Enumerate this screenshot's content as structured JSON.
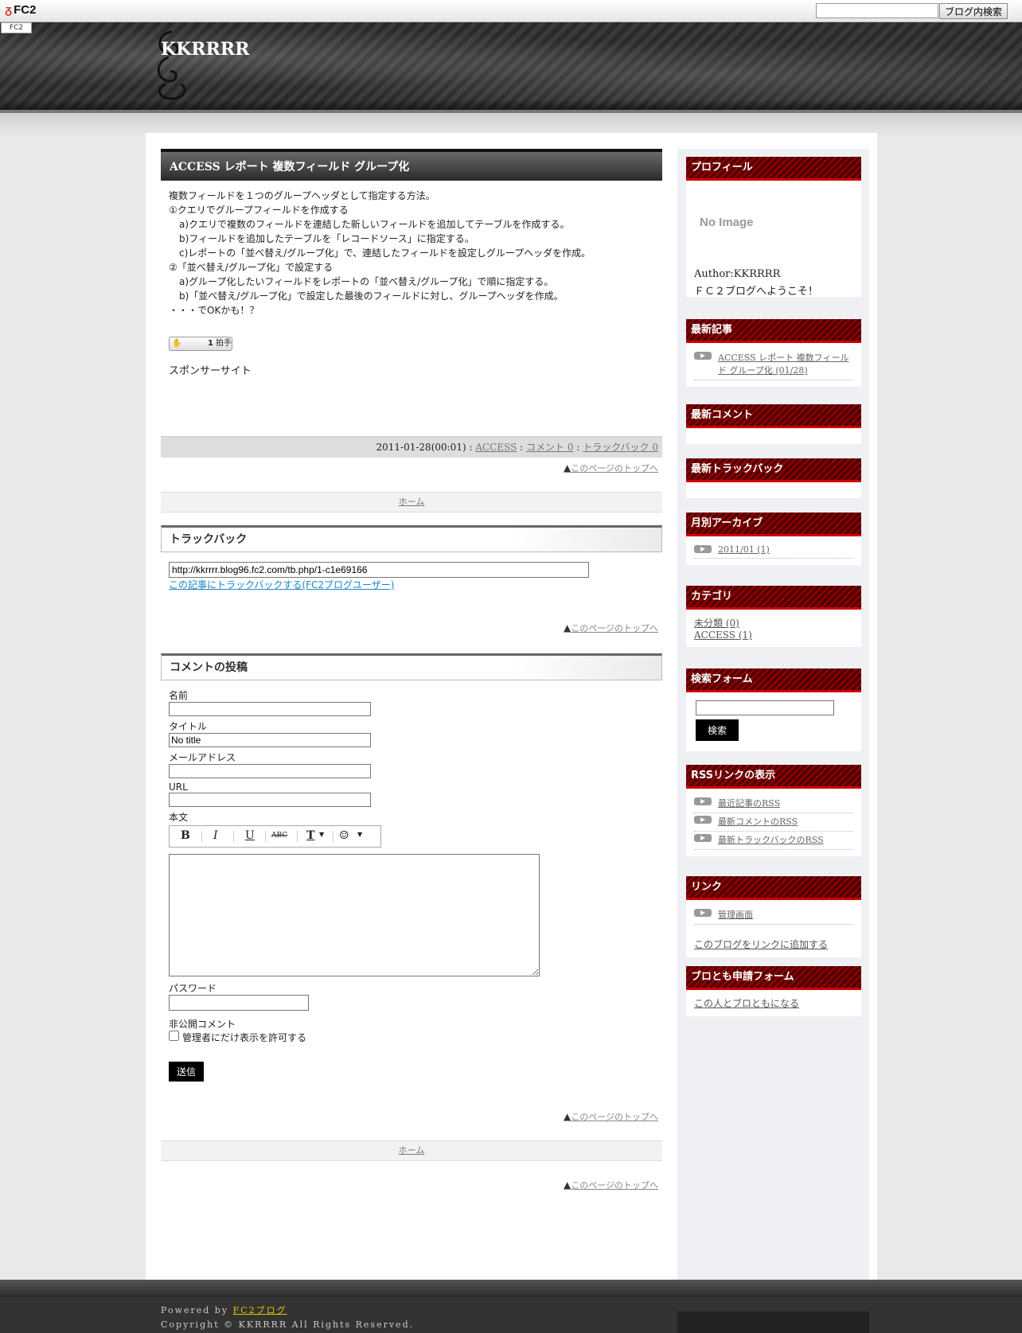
{
  "fc2bar": {
    "logo": "FC2",
    "search_placeholder": "",
    "search_button": "ブログ内検索",
    "mini_label": "FC2"
  },
  "header": {
    "blog_title": "KKRRRR"
  },
  "entry": {
    "title": "ACCESS レポート 複数フィールド グループ化",
    "lines": [
      "複数フィールドを１つのグループヘッダとして指定する方法。",
      "",
      "①クエリでグループフィールドを作成する",
      "a)クエリで複数のフィールドを連結した新しいフィールドを追加してテーブルを作成する。",
      "b)フィールドを追加したテーブルを「レコードソース」に指定する。",
      "c)レポートの「並べ替え/グループ化」で、連結したフィールドを設定しグループヘッダを作成。",
      "",
      "②「並べ替え/グループ化」で設定する",
      "a)グループ化したいフィールドをレポートの「並べ替え/グループ化」で順に指定する。",
      "b)「並べ替え/グループ化」で設定した最後のフィールドに対し、グループヘッダを作成。",
      "",
      "・・・でOKかも！？"
    ],
    "clap_count": "1",
    "clap_label": "拍手",
    "sponsor": "スポンサーサイト",
    "footer": {
      "date": "2011-01-28(00:01)",
      "sep": " : ",
      "category": "ACCESS",
      "comments": "コメント 0",
      "trackbacks": "トラックバック 0"
    }
  },
  "pagetop_label": "このページのトップへ",
  "home_label": "ホーム",
  "trackback": {
    "title": "トラックバック",
    "url": "http://kkrrrr.blog96.fc2.com/tb.php/1-c1e69166",
    "link": "この記事にトラックバックする(FC2ブログユーザー)"
  },
  "comment_form": {
    "title": "コメントの投稿",
    "name_label": "名前",
    "title_label": "タイトル",
    "title_value": "No title",
    "email_label": "メールアドレス",
    "url_label": "URL",
    "body_label": "本文",
    "toolbar": [
      "B",
      "I",
      "U",
      "ABC",
      "T",
      "☺"
    ],
    "password_label": "パスワード",
    "private_label": "非公開コメント",
    "private_check": "管理者にだけ表示を許可する",
    "submit": "送信"
  },
  "sidebar": {
    "profile": {
      "title": "プロフィール",
      "image": "No Image",
      "author": "Author:KKRRRR",
      "welcome": "ＦＣ２ブログへようこそ！"
    },
    "recent": {
      "title": "最新記事",
      "items": [
        "ACCESS レポート 複数フィールド グループ化 (01/28)"
      ]
    },
    "comments": {
      "title": "最新コメント"
    },
    "trackbacks": {
      "title": "最新トラックバック"
    },
    "archives": {
      "title": "月別アーカイブ",
      "items": [
        "2011/01 (1)"
      ]
    },
    "categories": {
      "title": "カテゴリ",
      "items": [
        "未分類 (0)",
        "ACCESS (1)"
      ]
    },
    "search": {
      "title": "検索フォーム",
      "button": "検索"
    },
    "rss": {
      "title": "RSSリンクの表示",
      "items": [
        "最近記事のRSS",
        "最新コメントのRSS",
        "最新トラックバックのRSS"
      ]
    },
    "links": {
      "title": "リンク",
      "items": [
        "管理画面"
      ],
      "add": "このブログをリンクに追加する"
    },
    "friends": {
      "title": "ブロとも申請フォーム",
      "link": "この人とブロともになる"
    }
  },
  "footer": {
    "powered": "Powered by ",
    "powered_link": "FC2ブログ",
    "copyright": "Copyright © KKRRRR All Rights Reserved."
  }
}
